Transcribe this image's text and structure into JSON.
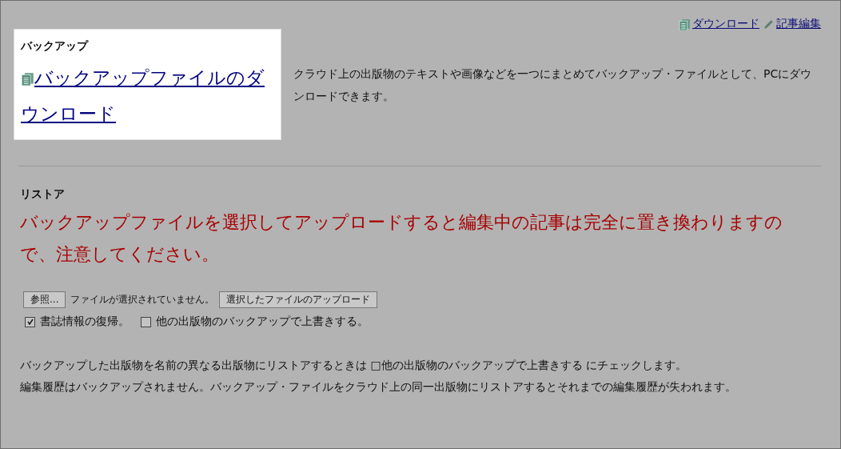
{
  "top_links": [
    {
      "kind": "download",
      "label": "ダウンロード"
    },
    {
      "kind": "edit",
      "label": "記事編集"
    }
  ],
  "backup": {
    "heading": "バックアップ",
    "link": "バックアップファイルのダウンロード",
    "description": "クラウド上の出版物のテキストや画像などを一つにまとめてバックアップ・ファイルとして、PCにダウンロードできます。"
  },
  "restore": {
    "heading": "リストア",
    "warning": "バックアップファイルを選択してアップロードすると編集中の記事は完全に置き換わりますので、注意してください。",
    "browse_button": "参照...",
    "file_status": "ファイルが選択されていません。",
    "upload_button": "選択したファイルのアップロード",
    "options": [
      {
        "label": "書誌情報の復帰。",
        "checked": true
      },
      {
        "label": "他の出版物のバックアップで上書きする。",
        "checked": false
      }
    ],
    "notes": [
      "バックアップした出版物を名前の異なる出版物にリストアするときは □他の出版物のバックアップで上書きする にチェックします。",
      "編集履歴はバックアップされません。バックアップ・ファイルをクラウド上の同一出版物にリストアするとそれまでの編集履歴が失われます。"
    ]
  }
}
